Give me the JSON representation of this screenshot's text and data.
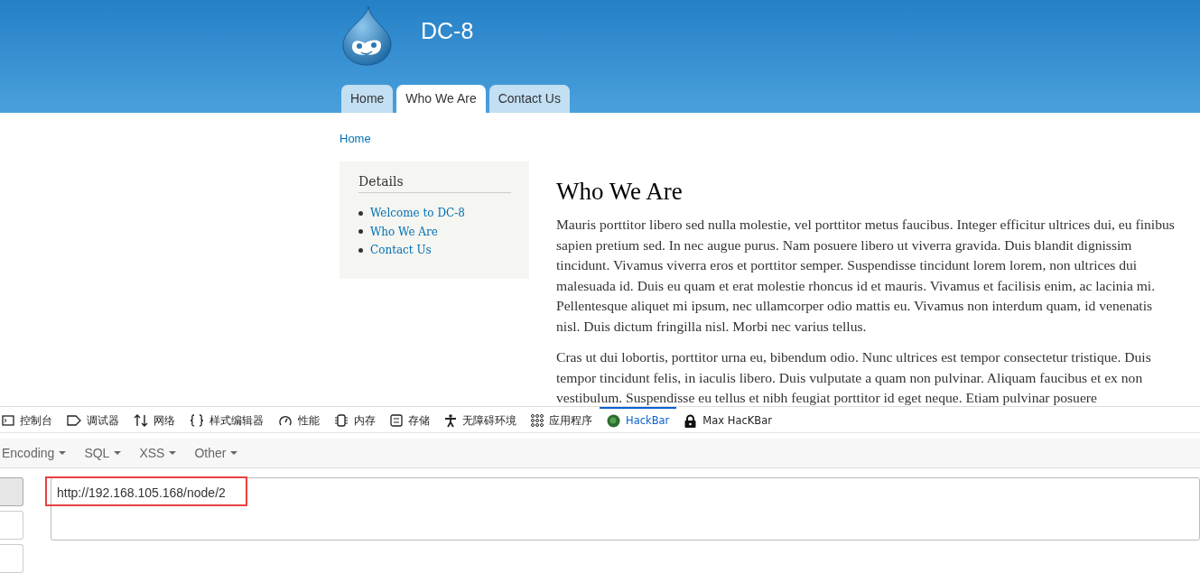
{
  "site": {
    "name": "DC-8"
  },
  "nav_tabs": [
    {
      "label": "Home",
      "selected": false
    },
    {
      "label": "Who We Are",
      "selected": true
    },
    {
      "label": "Contact Us",
      "selected": false
    }
  ],
  "breadcrumb": "Home",
  "sidebar": {
    "title": "Details",
    "links": [
      "Welcome to DC-8",
      "Who We Are",
      "Contact Us"
    ]
  },
  "article": {
    "title": "Who We Are",
    "paragraphs": [
      "Mauris porttitor libero sed nulla molestie, vel porttitor metus faucibus. Integer efficitur ultrices dui, eu finibus sapien pretium sed. In nec augue purus. Nam posuere libero ut viverra gravida. Duis blandit dignissim tincidunt. Vivamus viverra eros et porttitor semper. Suspendisse tincidunt lorem lorem, non ultrices dui malesuada id. Duis eu quam et erat molestie rhoncus id et mauris. Vivamus et facilisis enim, ac lacinia mi. Pellentesque aliquet mi ipsum, nec ullamcorper odio mattis eu. Vivamus non interdum quam, id venenatis nisl. Duis dictum fringilla nisl. Morbi nec varius tellus.",
      "Cras ut dui lobortis, porttitor urna eu, bibendum odio. Nunc ultrices est tempor consectetur tristique. Duis tempor tincidunt felis, in iaculis libero. Duis vulputate a quam non pulvinar. Aliquam faucibus et ex non vestibulum. Suspendisse eu tellus et nibh feugiat porttitor id eget neque. Etiam pulvinar posuere"
    ]
  },
  "devtools": {
    "tabs": [
      {
        "label": "控制台",
        "kind": "console",
        "selected": false
      },
      {
        "label": "调试器",
        "kind": "debugger",
        "selected": false
      },
      {
        "label": "网络",
        "kind": "network",
        "selected": false
      },
      {
        "label": "样式编辑器",
        "kind": "style",
        "selected": false
      },
      {
        "label": "性能",
        "kind": "performance",
        "selected": false
      },
      {
        "label": "内存",
        "kind": "memory",
        "selected": false
      },
      {
        "label": "存储",
        "kind": "storage",
        "selected": false
      },
      {
        "label": "无障碍环境",
        "kind": "accessibility",
        "selected": false
      },
      {
        "label": "应用程序",
        "kind": "apps",
        "selected": false
      },
      {
        "label": "HackBar",
        "kind": "hackbar",
        "selected": true
      },
      {
        "label": "Max HacKBar",
        "kind": "maxhackbar",
        "selected": false
      }
    ],
    "menus": [
      "Encoding",
      "SQL",
      "XSS",
      "Other"
    ],
    "url": {
      "value": "http://192.168.105.168/node/2",
      "highlighted": true
    }
  }
}
